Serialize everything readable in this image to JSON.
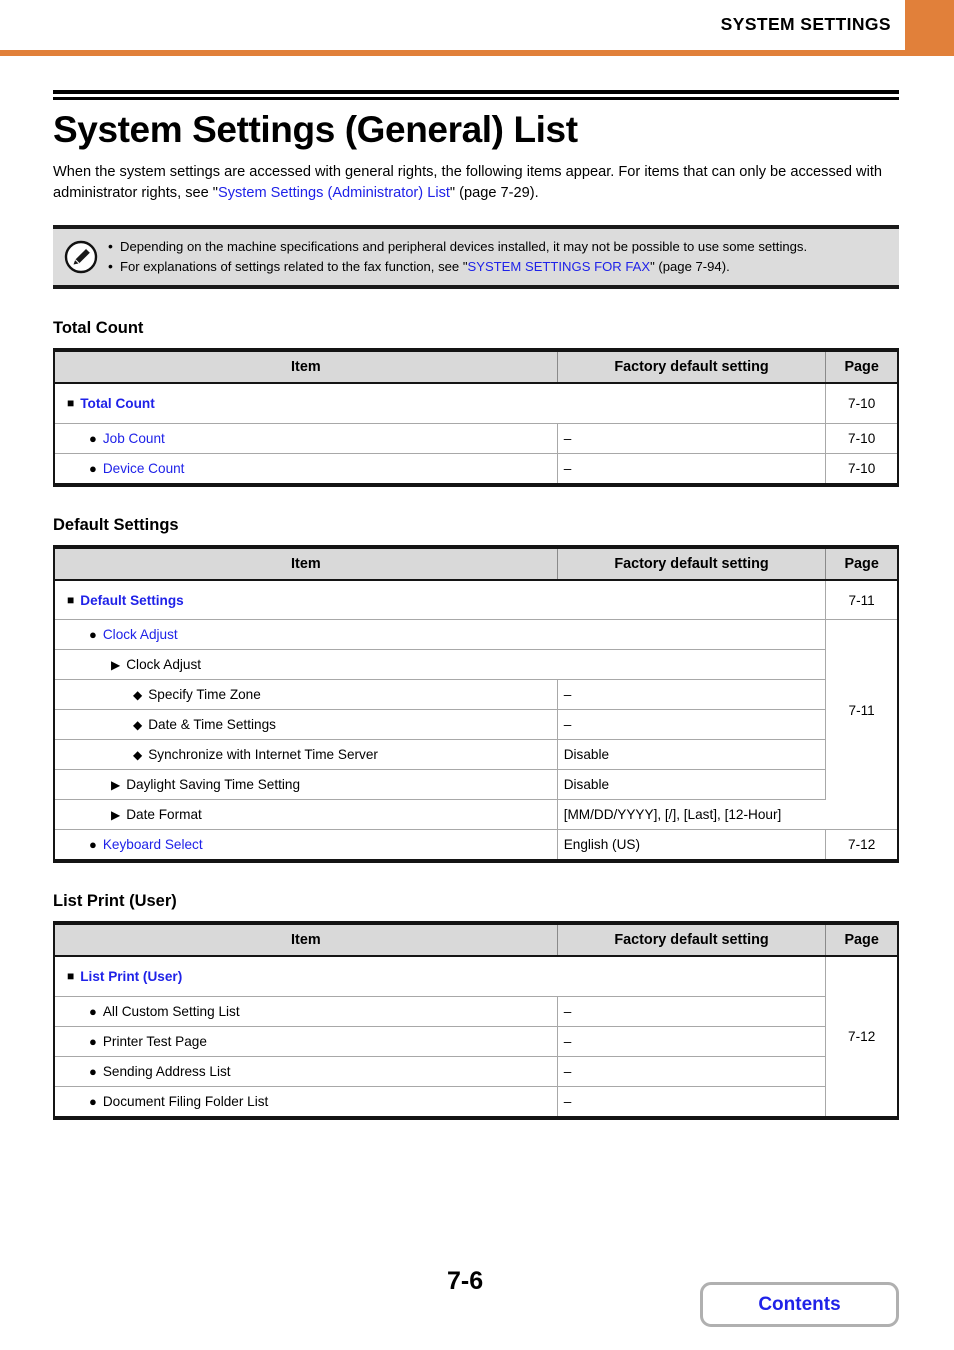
{
  "header": {
    "title": "SYSTEM SETTINGS",
    "accent_color": "#E1803A"
  },
  "document": {
    "title": "System Settings (General) List",
    "intro_part1": "When the system settings are accessed with general rights, the following items appear. For items that can only be accessed with administrator rights, see \"",
    "intro_link": "System Settings (Administrator) List",
    "intro_part2": "\" (page 7-29)."
  },
  "note": {
    "icon": "pencil-note-icon",
    "line1": "Depending on the machine specifications and peripheral devices installed, it may not be possible to use some settings.",
    "line2_part1": "For explanations of settings related to the fax function, see \"",
    "line2_link": "SYSTEM SETTINGS FOR FAX",
    "line2_part2": "\" (page 7-94)."
  },
  "columns": {
    "item": "Item",
    "factory": "Factory default setting",
    "page": "Page"
  },
  "sections": [
    {
      "heading": "Total Count",
      "rows": [
        {
          "level": 1,
          "marker": "square",
          "label": "Total Count",
          "link": true,
          "span_item": true,
          "factory": "",
          "page": "7-10",
          "page_rowspan": 1
        },
        {
          "level": 2,
          "marker": "circle",
          "label": "Job Count",
          "link": true,
          "factory": "–",
          "page": "7-10",
          "page_rowspan": 1
        },
        {
          "level": 2,
          "marker": "circle",
          "label": "Device Count",
          "link": true,
          "factory": "–",
          "page": "7-10",
          "page_rowspan": 1
        }
      ]
    },
    {
      "heading": "Default Settings",
      "rows": [
        {
          "level": 1,
          "marker": "square",
          "label": "Default Settings",
          "link": true,
          "span_item": true,
          "factory": "",
          "page": "7-11",
          "page_rowspan": 1
        },
        {
          "level": 2,
          "marker": "circle",
          "label": "Clock Adjust",
          "link": true,
          "span_item": true,
          "factory": "",
          "page": "7-11",
          "page_rowspan": 6
        },
        {
          "level": 3,
          "marker": "triangle",
          "label": "Clock Adjust",
          "link": false,
          "span_item": true,
          "factory": ""
        },
        {
          "level": 4,
          "marker": "diamond",
          "label": "Specify Time Zone",
          "link": false,
          "factory": "–"
        },
        {
          "level": 4,
          "marker": "diamond",
          "label": "Date & Time Settings",
          "link": false,
          "factory": "–"
        },
        {
          "level": 4,
          "marker": "diamond",
          "label": "Synchronize with Internet Time Server",
          "link": false,
          "factory": "Disable"
        },
        {
          "level": 3,
          "marker": "triangle",
          "label": "Daylight Saving Time Setting",
          "link": false,
          "factory": "Disable"
        },
        {
          "level": 3,
          "marker": "triangle",
          "label": "Date Format",
          "link": false,
          "factory": "[MM/DD/YYYY], [/], [Last], [12-Hour]"
        },
        {
          "level": 2,
          "marker": "circle",
          "label": "Keyboard Select",
          "link": true,
          "factory": "English (US)",
          "page": "7-12",
          "page_rowspan": 1
        }
      ]
    },
    {
      "heading": "List Print (User)",
      "rows": [
        {
          "level": 1,
          "marker": "square",
          "label": "List Print (User)",
          "link": true,
          "span_item": true,
          "factory": "",
          "page": "7-12",
          "page_rowspan": 5
        },
        {
          "level": 2,
          "marker": "circle",
          "label": "All Custom Setting List",
          "link": false,
          "factory": "–"
        },
        {
          "level": 2,
          "marker": "circle",
          "label": "Printer Test Page",
          "link": false,
          "factory": "–"
        },
        {
          "level": 2,
          "marker": "circle",
          "label": "Sending Address List",
          "link": false,
          "factory": "–"
        },
        {
          "level": 2,
          "marker": "circle",
          "label": "Document Filing Folder List",
          "link": false,
          "factory": "–"
        }
      ]
    }
  ],
  "footer": {
    "page_number": "7-6",
    "contents_label": "Contents"
  }
}
